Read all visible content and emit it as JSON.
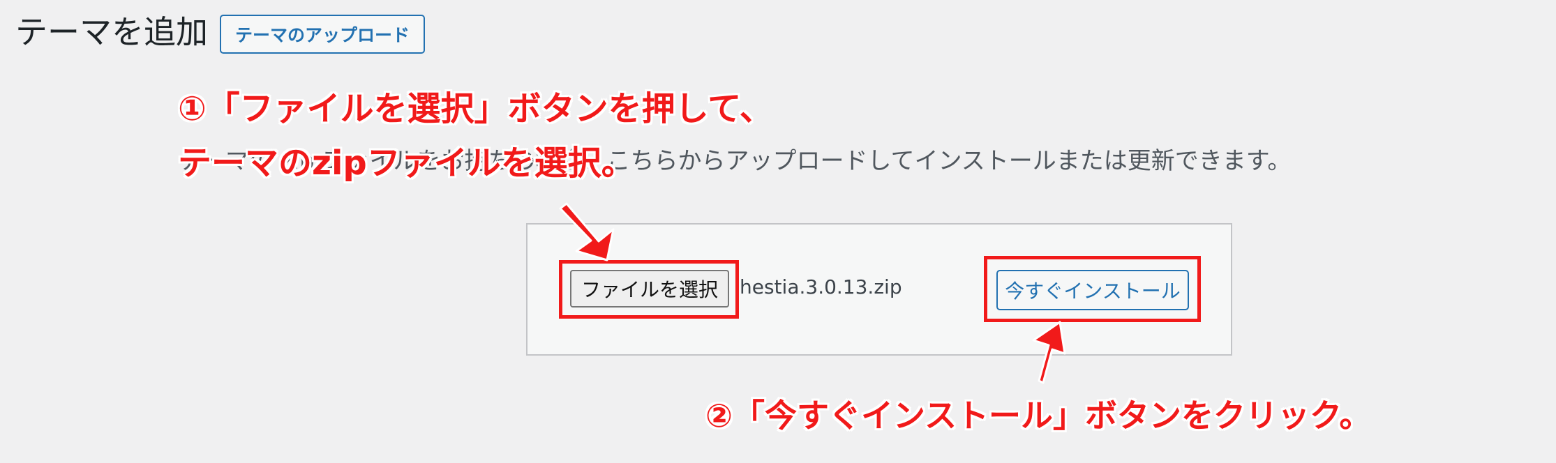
{
  "page": {
    "title": "テーマを追加",
    "upload_button_label": "テーマのアップロード",
    "help_text": "テーマの zip ファイルをお持ちの場合、こちらからアップロードしてインストールまたは更新できます。"
  },
  "upload_form": {
    "file_button_label": "ファイルを選択",
    "file_name": "hestia.3.0.13.zip",
    "install_button_label": "今すぐインストール"
  },
  "annotations": {
    "step1_line1": "①「ファイルを選択」ボタンを押して、",
    "step1_line2": "テーマのzipファイルを選択。",
    "step2": "②「今すぐインストール」ボタンをクリック。"
  },
  "colors": {
    "annotation_red": "#f11a1a",
    "wp_blue": "#2271b1",
    "background": "#f0f0f1"
  }
}
